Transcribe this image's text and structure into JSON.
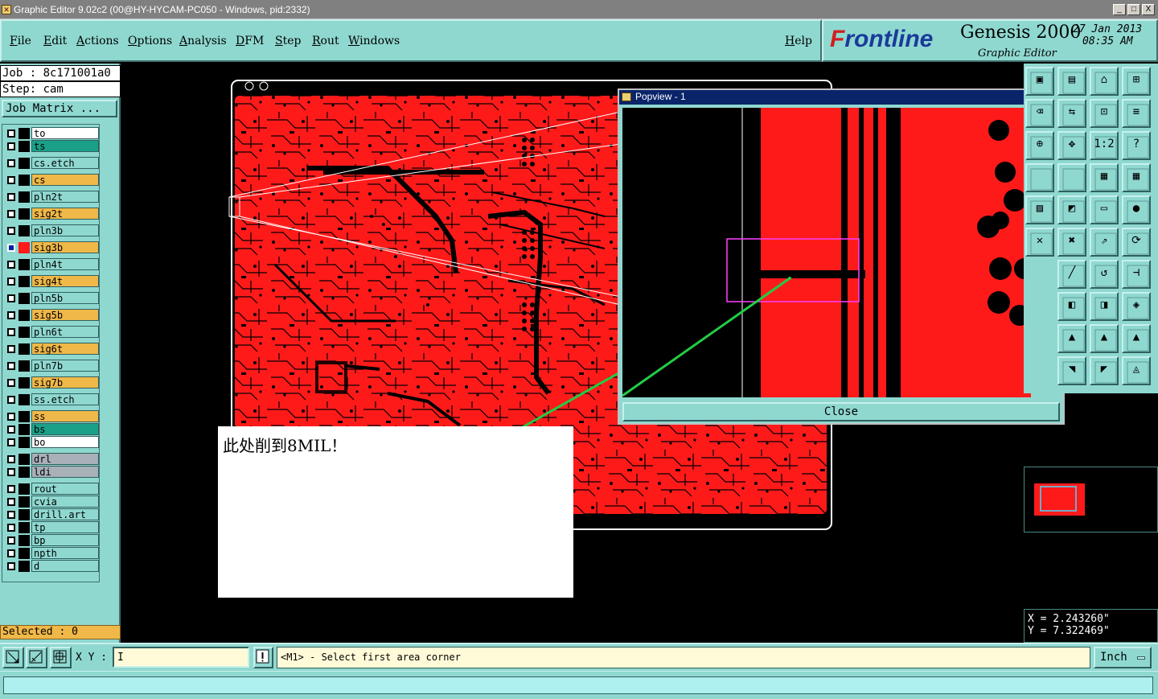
{
  "window": {
    "title": "Graphic Editor 9.02c2 (00@HY-HYCAM-PC050 - Windows, pid:2332)",
    "min": "_",
    "max": "□",
    "close": "X"
  },
  "menu": {
    "items": [
      "File",
      "Edit",
      "Actions",
      "Options",
      "Analysis",
      "DFM",
      "Step",
      "Rout",
      "Windows"
    ],
    "help": "Help"
  },
  "brand": {
    "logo": "Frontline",
    "product": "Genesis 2000",
    "subtitle": "Graphic Editor",
    "date": "27 Jan 2013",
    "time": "08:35 AM"
  },
  "job": {
    "job_label": "Job : 8c171001a0",
    "step_label": "Step: cam",
    "matrix_button": "Job Matrix ..."
  },
  "layers": [
    {
      "name": "to",
      "color": "#ffffff"
    },
    {
      "name": "ts",
      "color": "#1aa088"
    },
    {
      "name": "cs.etch",
      "color": "#8fd8d0"
    },
    {
      "name": "cs",
      "color": "#f0b848"
    },
    {
      "name": "pln2t",
      "color": "#8fd8d0"
    },
    {
      "name": "sig2t",
      "color": "#f0b848"
    },
    {
      "name": "pln3b",
      "color": "#8fd8d0"
    },
    {
      "name": "sig3b",
      "color": "#f0b848",
      "active": true
    },
    {
      "name": "pln4t",
      "color": "#8fd8d0"
    },
    {
      "name": "sig4t",
      "color": "#f0b848"
    },
    {
      "name": "pln5b",
      "color": "#8fd8d0"
    },
    {
      "name": "sig5b",
      "color": "#f0b848"
    },
    {
      "name": "pln6t",
      "color": "#8fd8d0"
    },
    {
      "name": "sig6t",
      "color": "#f0b848"
    },
    {
      "name": "pln7b",
      "color": "#8fd8d0"
    },
    {
      "name": "sig7b",
      "color": "#f0b848"
    },
    {
      "name": "ss.etch",
      "color": "#8fd8d0"
    },
    {
      "name": "ss",
      "color": "#f0b848"
    },
    {
      "name": "bs",
      "color": "#1aa088"
    },
    {
      "name": "bo",
      "color": "#ffffff"
    },
    {
      "name": "drl",
      "color": "#a8b0b8"
    },
    {
      "name": "ldi",
      "color": "#a8b0b8"
    },
    {
      "name": "rout",
      "color": "#8fd8d0"
    },
    {
      "name": "cvia",
      "color": "#8fd8d0"
    },
    {
      "name": "drill.art",
      "color": "#8fd8d0"
    },
    {
      "name": "tp",
      "color": "#8fd8d0"
    },
    {
      "name": "bp",
      "color": "#8fd8d0"
    },
    {
      "name": "npth",
      "color": "#8fd8d0"
    },
    {
      "name": "d",
      "color": "#8fd8d0"
    }
  ],
  "selected_label": "Selected : 0",
  "popview": {
    "title": "Popview - 1",
    "close_button": "Close"
  },
  "annotation": {
    "text": "此处削到8MIL！"
  },
  "coords": {
    "x": "X = 2.243260\"",
    "y": "Y = 7.322469\""
  },
  "bottom": {
    "xy_label": "X Y :",
    "xy_value": "I",
    "prompt": "<M1> - Select first area corner",
    "unit": "Inch"
  },
  "colors": {
    "panel": "#8fd8d0",
    "copper": "#ff1a1a",
    "highlight": "#f0b848",
    "zoom_box": "#ff40ff",
    "pointer_line": "#22cc44"
  }
}
